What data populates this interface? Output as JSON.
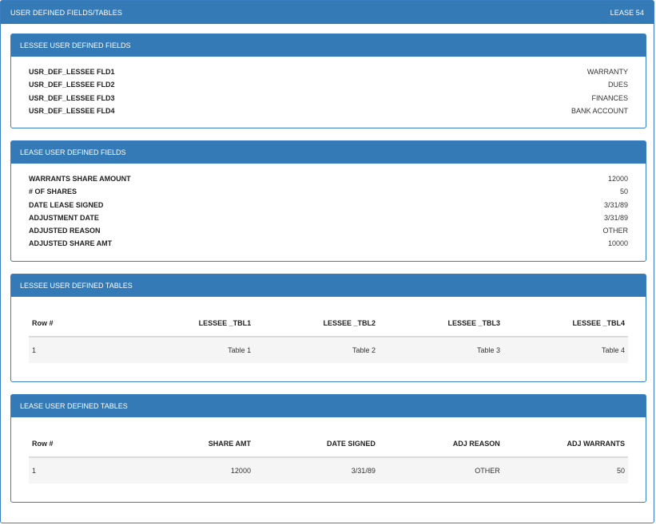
{
  "window": {
    "title": "USER DEFINED FIELDS/TABLES",
    "lease_label": "LEASE 54"
  },
  "lessee_fields": {
    "title": "LESSEE USER DEFINED FIELDS",
    "items": [
      {
        "key": "USR_DEF_LESSEE FLD1",
        "value": "WARRANTY"
      },
      {
        "key": "USR_DEF_LESSEE FLD2",
        "value": "DUES"
      },
      {
        "key": "USR_DEF_LESSEE FLD3",
        "value": "FINANCES"
      },
      {
        "key": "USR_DEF_LESSEE FLD4",
        "value": "BANK ACCOUNT"
      }
    ]
  },
  "lease_fields": {
    "title": "LEASE USER DEFINED FIELDS",
    "items": [
      {
        "key": "WARRANTS SHARE AMOUNT",
        "value": "12000"
      },
      {
        "key": "# OF SHARES",
        "value": "50"
      },
      {
        "key": "DATE LEASE SIGNED",
        "value": "3/31/89"
      },
      {
        "key": "ADJUSTMENT DATE",
        "value": "3/31/89"
      },
      {
        "key": "ADJUSTED REASON",
        "value": "OTHER"
      },
      {
        "key": "ADJUSTED SHARE AMT",
        "value": "10000"
      }
    ]
  },
  "lessee_tables": {
    "title": "LESSEE USER DEFINED TABLES",
    "columns": [
      "Row #",
      "LESSEE _TBL1",
      "LESSEE _TBL2",
      "LESSEE _TBL3",
      "LESSEE _TBL4"
    ],
    "rows": [
      [
        "1",
        "Table 1",
        "Table 2",
        "Table 3",
        "Table 4"
      ]
    ]
  },
  "lease_tables": {
    "title": "LEASE USER DEFINED TABLES",
    "columns": [
      "Row #",
      "SHARE AMT",
      "DATE SIGNED",
      "ADJ REASON",
      "ADJ WARRANTS"
    ],
    "rows": [
      [
        "1",
        "12000",
        "3/31/89",
        "OTHER",
        "50"
      ]
    ]
  }
}
